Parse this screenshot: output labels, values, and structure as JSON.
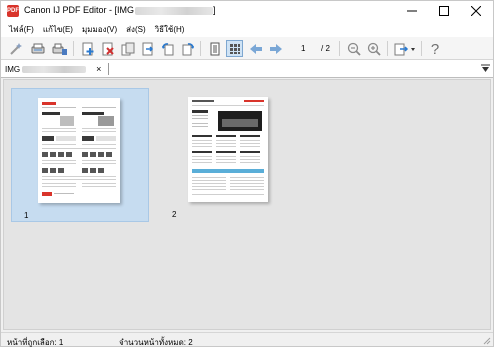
{
  "window": {
    "title_prefix": "Canon IJ PDF Editor - [IMG",
    "title_suffix": "]",
    "app_icon_text": "PDF"
  },
  "menu": {
    "items": [
      "ไฟล์(F)",
      "แก้ไข(E)",
      "มุมมอง(V)",
      "ส่ง(S)",
      "วิธีใช้(H)"
    ]
  },
  "toolbar": {
    "current_page": "1",
    "total_pages": "/ 2",
    "icons": [
      "wand-icon",
      "scan-icon",
      "scan-settings-icon",
      "add-page-icon",
      "delete-page-icon",
      "insert-page-icon",
      "extract-page-icon",
      "rotate-left-icon",
      "rotate-right-icon",
      "page-view-icon",
      "thumbnail-view-icon",
      "previous-page-icon",
      "next-page-icon",
      "zoom-out-icon",
      "zoom-in-icon",
      "export-icon",
      "help-icon"
    ]
  },
  "tab": {
    "label": "IMG",
    "close": "×"
  },
  "thumbnails": [
    {
      "label": "1",
      "selected": true
    },
    {
      "label": "2",
      "selected": false
    }
  ],
  "status": {
    "selected_pages": "หน้าที่ถูกเลือก: 1",
    "total_pages": "จำนวนหน้าทั้งหมด: 2"
  },
  "colors": {
    "selection": "#c6dcf0",
    "accent_red": "#d9342b",
    "arrow_blue": "#7aa7d6"
  }
}
